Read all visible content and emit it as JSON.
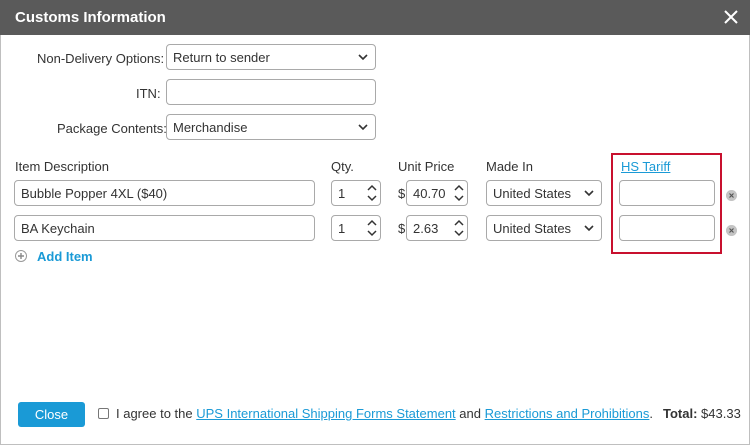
{
  "dialog": {
    "title": "Customs Information"
  },
  "form": {
    "non_delivery": {
      "label": "Non-Delivery Options:",
      "value": "Return to sender"
    },
    "itn": {
      "label": "ITN:",
      "value": ""
    },
    "package_contents": {
      "label": "Package Contents:",
      "value": "Merchandise"
    }
  },
  "items_table": {
    "headers": {
      "description": "Item Description",
      "qty": "Qty.",
      "unit_price": "Unit Price",
      "made_in": "Made In",
      "hs_tariff": "HS Tariff"
    },
    "currency_symbol": "$",
    "rows": [
      {
        "description": "Bubble Popper 4XL ($40)",
        "qty": "1",
        "unit_price": "40.70",
        "made_in": "United States",
        "hs_tariff": ""
      },
      {
        "description": "BA Keychain",
        "qty": "1",
        "unit_price": "2.63",
        "made_in": "United States",
        "hs_tariff": ""
      }
    ],
    "add_item_label": "Add Item"
  },
  "footer": {
    "close_label": "Close",
    "agree_prefix": "I agree to the",
    "forms_link": "UPS International Shipping Forms Statement",
    "agree_and": "and",
    "restrictions_link": "Restrictions and Prohibitions",
    "agree_suffix": ".",
    "total_label": "Total:",
    "total_value": "$43.33"
  },
  "colors": {
    "titlebar": "#5a5a5a",
    "accent": "#1a9ad6",
    "highlight": "#c8102e"
  }
}
